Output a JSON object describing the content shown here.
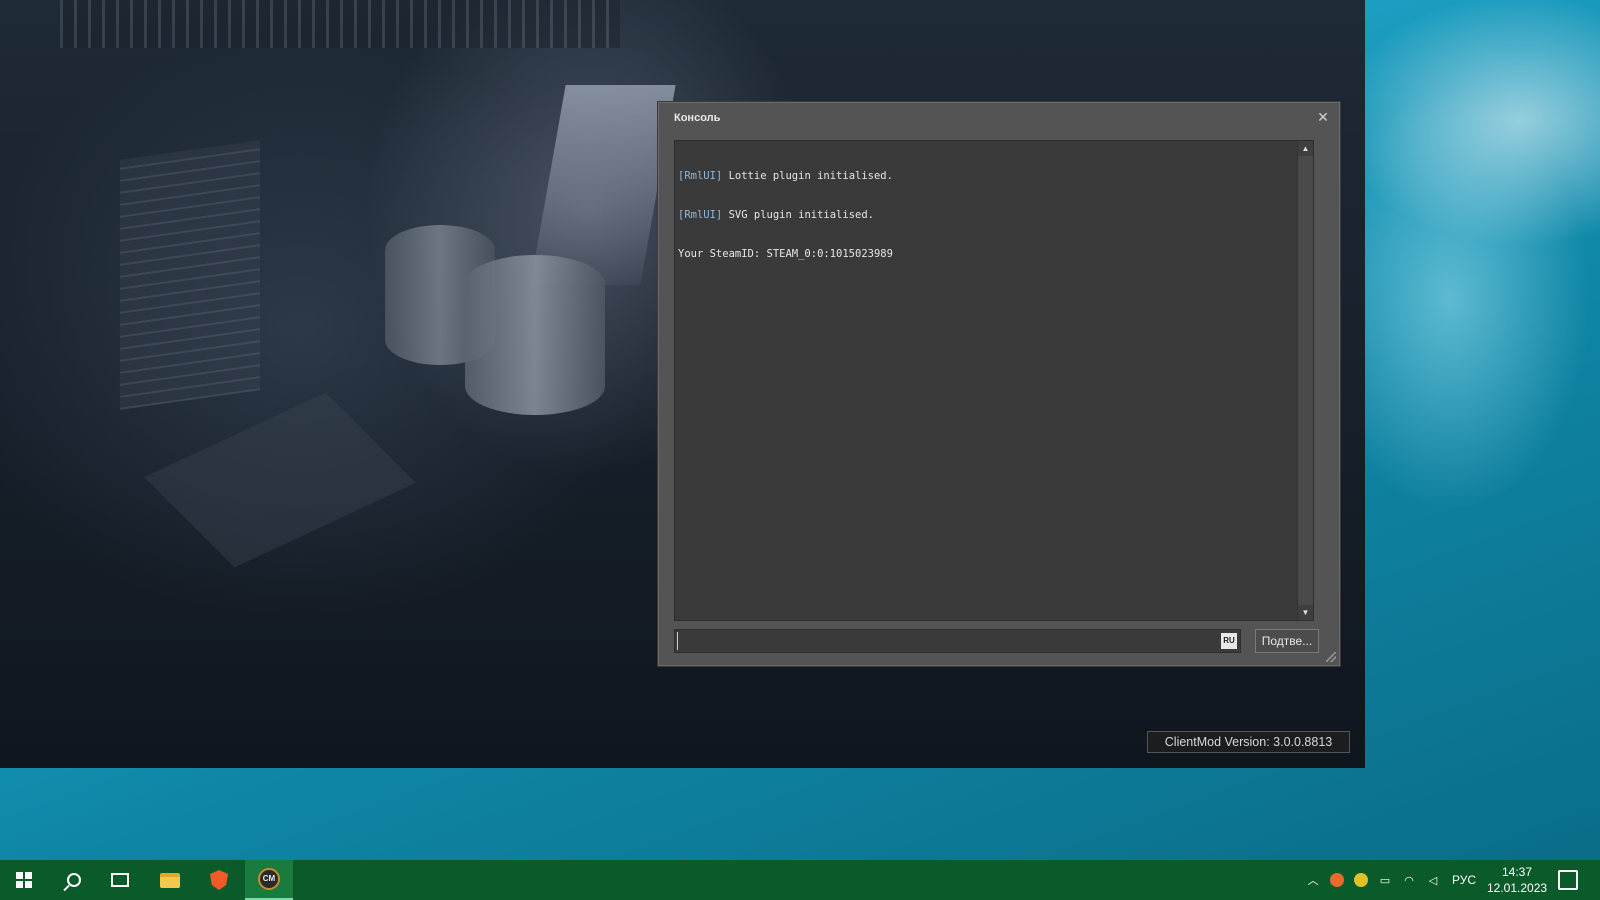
{
  "console": {
    "title": "Консоль",
    "close_label": "✕",
    "lines": [
      {
        "tag": "[RmlUI]",
        "text": " Lottie plugin initialised."
      },
      {
        "tag": "[RmlUI]",
        "text": " SVG plugin initialised."
      },
      {
        "tag": "",
        "text": "Your SteamID: STEAM_0:0:1015023989"
      }
    ],
    "input_value": "",
    "language_indicator": "RU",
    "submit_label": "Подтве...",
    "scroll_up": "▲",
    "scroll_down": "▼"
  },
  "game": {
    "version_text": "ClientMod Version: 3.0.0.8813"
  },
  "taskbar": {
    "apps": [
      {
        "name": "start",
        "icon": "windows-logo-icon"
      },
      {
        "name": "search",
        "icon": "search-icon"
      },
      {
        "name": "task-view",
        "icon": "task-view-icon"
      },
      {
        "name": "file-explorer",
        "icon": "folder-icon"
      },
      {
        "name": "brave",
        "icon": "brave-browser-icon"
      },
      {
        "name": "clientmod",
        "icon": "clientmod-icon",
        "label": "CM",
        "active": true
      }
    ],
    "tray": {
      "language": "РУС",
      "time": "14:37",
      "date": "12.01.2023"
    }
  },
  "colors": {
    "taskbar_bg": "#0b5b2a",
    "taskbar_active": "#1a7b3e",
    "console_bg": "#545454",
    "console_output_bg": "#3a3a3a",
    "log_tag": "#8fb8d8"
  }
}
